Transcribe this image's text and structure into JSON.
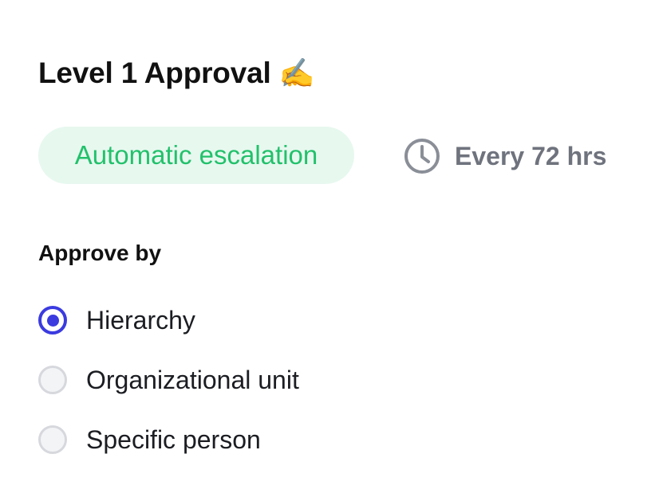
{
  "level": {
    "title": "Level 1 Approval",
    "title_emoji": "✍️"
  },
  "escalation": {
    "label": "Automatic escalation",
    "frequency_icon": "clock-icon",
    "frequency_text": "Every 72 hrs",
    "pill_bg_color": "#e7f8ef",
    "pill_text_color": "#22c16b"
  },
  "approve_by": {
    "label": "Approve by",
    "selected": "Hierarchy",
    "accent_color": "#3b3be0",
    "options": [
      {
        "label": "Hierarchy",
        "checked": true
      },
      {
        "label": "Organizational unit",
        "checked": false
      },
      {
        "label": "Specific person",
        "checked": false
      }
    ]
  }
}
